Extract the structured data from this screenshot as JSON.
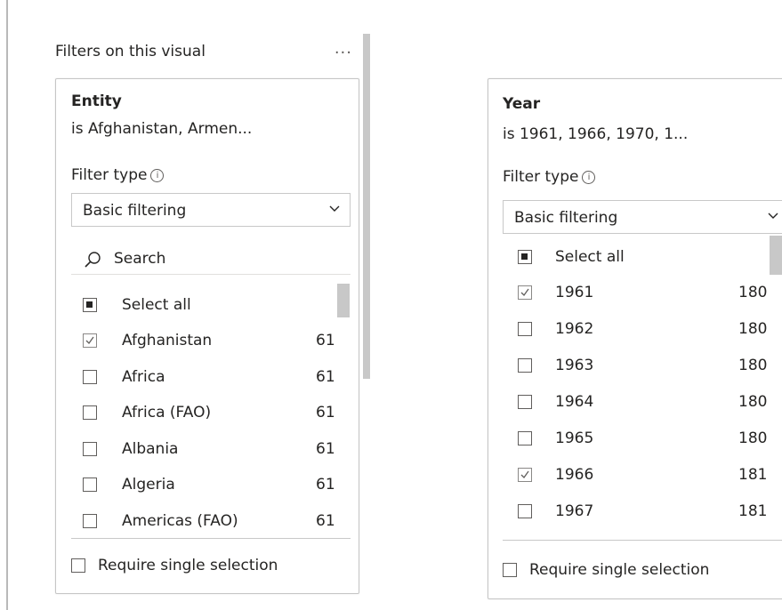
{
  "pane": {
    "title": "Filters on this visual",
    "more_label": "..."
  },
  "filters": [
    {
      "field": "Entity",
      "summary": "is Afghanistan, Armen...",
      "filter_type_label": "Filter type",
      "filter_type_value": "Basic filtering",
      "search_placeholder": "Search",
      "select_all": "Select all",
      "items": [
        {
          "name": "Afghanistan",
          "count": "61",
          "checked": true
        },
        {
          "name": "Africa",
          "count": "61",
          "checked": false
        },
        {
          "name": "Africa (FAO)",
          "count": "61",
          "checked": false
        },
        {
          "name": "Albania",
          "count": "61",
          "checked": false
        },
        {
          "name": "Algeria",
          "count": "61",
          "checked": false
        },
        {
          "name": "Americas (FAO)",
          "count": "61",
          "checked": false
        }
      ],
      "require_single": "Require single selection"
    },
    {
      "field": "Year",
      "summary": "is 1961, 1966, 1970, 1...",
      "filter_type_label": "Filter type",
      "filter_type_value": "Basic filtering",
      "select_all": "Select all",
      "items": [
        {
          "name": "1961",
          "count": "180",
          "checked": true
        },
        {
          "name": "1962",
          "count": "180",
          "checked": false
        },
        {
          "name": "1963",
          "count": "180",
          "checked": false
        },
        {
          "name": "1964",
          "count": "180",
          "checked": false
        },
        {
          "name": "1965",
          "count": "180",
          "checked": false
        },
        {
          "name": "1966",
          "count": "181",
          "checked": true
        },
        {
          "name": "1967",
          "count": "181",
          "checked": false
        }
      ],
      "require_single": "Require single selection"
    }
  ],
  "icons": {
    "info": "info-icon",
    "chevron": "chevron-down-icon",
    "search": "search-icon",
    "more": "more-options-icon"
  },
  "colors": {
    "border": "#c6c6c6",
    "text": "#252423",
    "scrollbar": "#c8c8c8"
  }
}
